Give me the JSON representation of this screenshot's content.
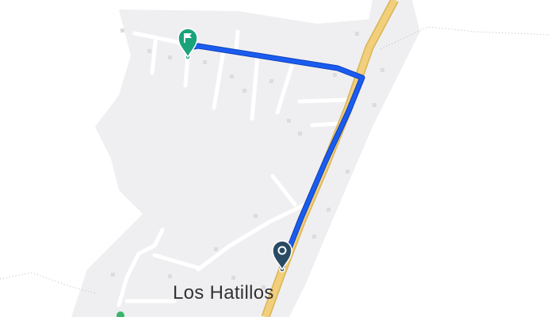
{
  "map": {
    "place_label": "Los Hatillos",
    "colors": {
      "route": "#1a5cf0",
      "route_casing": "#0f3fb8",
      "highway": "#f2cf7a",
      "start_marker": "#2a4a63",
      "destination_marker": "#1aa37a",
      "land": "#efeff1",
      "road": "#ffffff"
    },
    "markers": [
      {
        "type": "origin",
        "icon": "origin-pin-icon"
      },
      {
        "type": "destination",
        "icon": "flag-pin-icon"
      }
    ]
  }
}
